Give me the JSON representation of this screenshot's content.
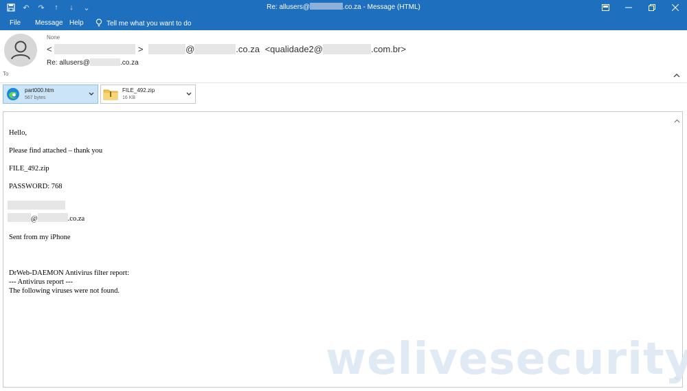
{
  "window": {
    "title_prefix": "Re: allusers@",
    "title_suffix": ".co.za  -  Message (HTML)"
  },
  "menu": {
    "file": "File",
    "message": "Message",
    "help": "Help",
    "tell_me": "Tell me what you want to do"
  },
  "header": {
    "importance": "None",
    "from_open": "<",
    "from_close": ">",
    "from_at": "@",
    "from_domain": ".co.za",
    "cc_prefix": "<qualidade2@",
    "cc_suffix": ".com.br>",
    "subject_prefix": "Re:  allusers@",
    "subject_suffix": ".co.za",
    "to_label": "To"
  },
  "attachments": [
    {
      "name": "part000.htm",
      "size": "567 bytes",
      "icon": "edge-browser-icon"
    },
    {
      "name": "FILE_492.zip",
      "size": "16 KB",
      "icon": "zip-folder-icon"
    }
  ],
  "body": {
    "greeting": "Hello,",
    "line1": "Please find attached – thank you",
    "filename": "FILE_492.zip",
    "password": "PASSWORD: 768",
    "sig_at": "@",
    "sig_domain": ".co.za",
    "sent_from": "Sent from my iPhone",
    "report_title": "DrWeb-DAEMON Antivirus filter report:",
    "report_line": "--- Antivirus report ---",
    "report_result": "The following viruses were not found."
  },
  "watermark": "welivesecurity",
  "colors": {
    "accent": "#1f6fbf",
    "attachment_selected": "#cce4f7",
    "redaction": "#e6e6e6"
  }
}
